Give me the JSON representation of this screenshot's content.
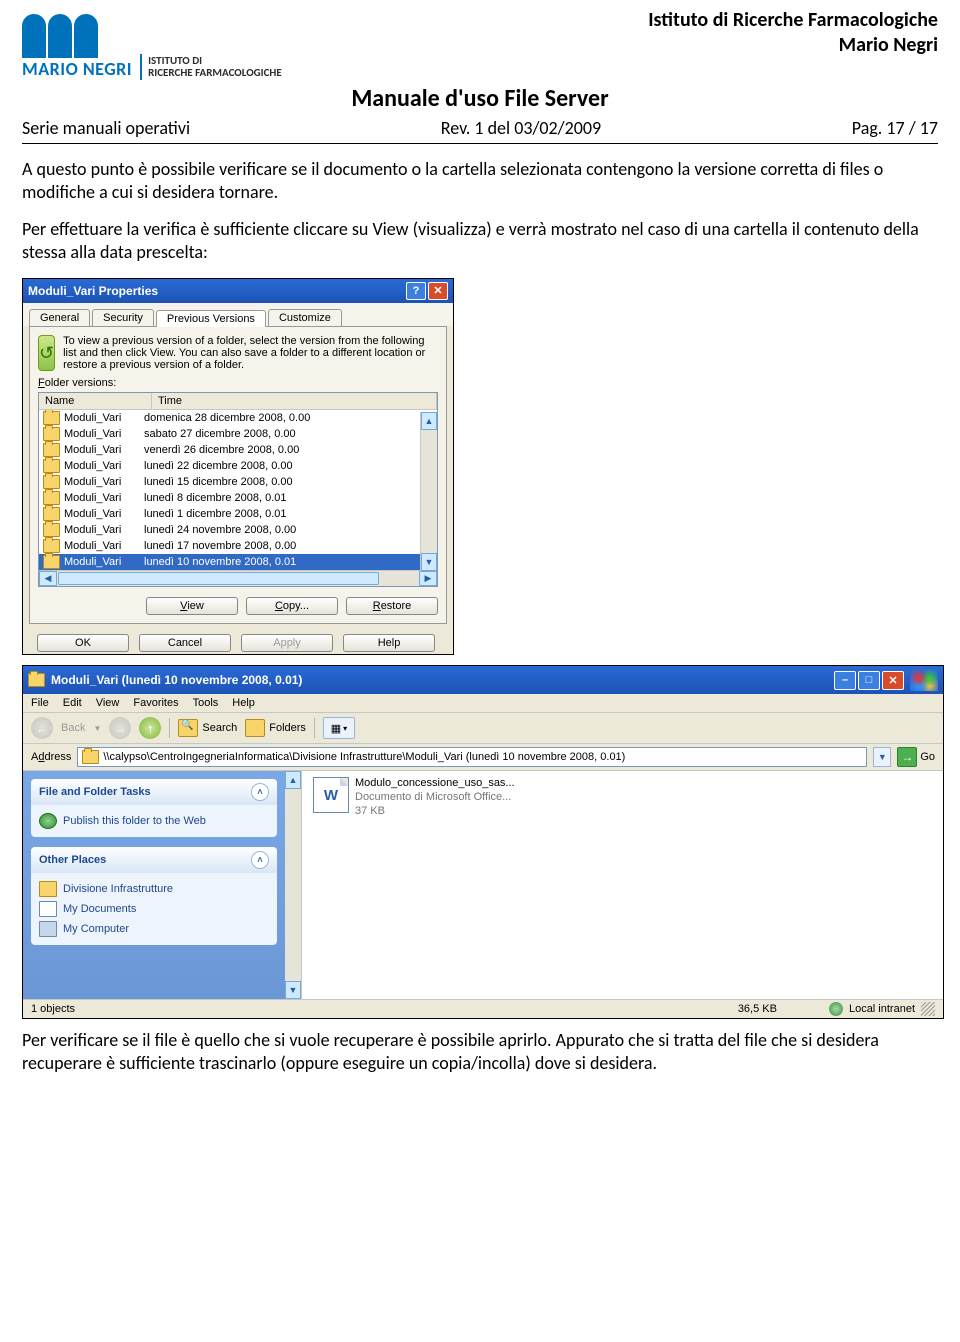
{
  "header": {
    "org_line1": "Istituto di Ricerche Farmacologiche",
    "org_line2": "Mario Negri",
    "logo_main": "MARIO NEGRI",
    "logo_sub": "ISTITUTO DI\nRICERCHE FARMACOLOGICHE",
    "title": "Manuale d'uso File Server",
    "series": "Serie manuali operativi",
    "rev": "Rev. 1 del 03/02/2009",
    "page": "Pag. 17 / 17"
  },
  "body": {
    "p1": "A questo punto è possibile verificare se il documento o la cartella selezionata contengono la versione corretta di files o modifiche a cui si desidera tornare.",
    "p2": "Per effettuare la verifica è sufficiente cliccare su View (visualizza) e verrà mostrato nel caso di una cartella il contenuto della stessa alla data prescelta:",
    "p3": "Per verificare se il file è quello che si vuole recuperare è possibile aprirlo. Appurato che si tratta del file che si desidera recuperare è sufficiente trascinarlo (oppure eseguire un copia/incolla) dove si desidera."
  },
  "dialog": {
    "title": "Moduli_Vari Properties",
    "tabs": [
      "General",
      "Security",
      "Previous Versions",
      "Customize"
    ],
    "intro": "To view a previous version of a folder, select the version from the following list and then click View. You can also save a folder to a different location or restore a previous version of a folder.",
    "versions_label": "Folder versions:",
    "cols": {
      "name": "Name",
      "time": "Time"
    },
    "rows": [
      {
        "name": "Moduli_Vari",
        "time": "domenica 28 dicembre 2008, 0.00"
      },
      {
        "name": "Moduli_Vari",
        "time": "sabato 27 dicembre 2008, 0.00"
      },
      {
        "name": "Moduli_Vari",
        "time": "venerdì 26 dicembre 2008, 0.00"
      },
      {
        "name": "Moduli_Vari",
        "time": "lunedì 22 dicembre 2008, 0.00"
      },
      {
        "name": "Moduli_Vari",
        "time": "lunedì 15 dicembre 2008, 0.00"
      },
      {
        "name": "Moduli_Vari",
        "time": "lunedì 8 dicembre 2008, 0.01"
      },
      {
        "name": "Moduli_Vari",
        "time": "lunedì 1 dicembre 2008, 0.01"
      },
      {
        "name": "Moduli_Vari",
        "time": "lunedì 24 novembre 2008, 0.00"
      },
      {
        "name": "Moduli_Vari",
        "time": "lunedì 17 novembre 2008, 0.00"
      },
      {
        "name": "Moduli_Vari",
        "time": "lunedì 10 novembre 2008, 0.01"
      }
    ],
    "btns": {
      "view": "View",
      "copy": "Copy...",
      "restore": "Restore",
      "ok": "OK",
      "cancel": "Cancel",
      "apply": "Apply",
      "help": "Help"
    }
  },
  "explorer": {
    "title": "Moduli_Vari (lunedì 10 novembre 2008, 0.01)",
    "menu": [
      "File",
      "Edit",
      "View",
      "Favorites",
      "Tools",
      "Help"
    ],
    "toolbar": {
      "back": "Back",
      "search": "Search",
      "folders": "Folders"
    },
    "address_label": "Address",
    "address": "\\\\calypso\\CentroIngegneriaInformatica\\Divisione Infrastrutture\\Moduli_Vari (lunedì 10 novembre 2008, 0.01)",
    "go": "Go",
    "tasks": {
      "title": "File and Folder Tasks",
      "items": [
        "Publish this folder to the Web"
      ]
    },
    "places": {
      "title": "Other Places",
      "items": [
        "Divisione Infrastrutture",
        "My Documents",
        "My Computer"
      ]
    },
    "file": {
      "name": "Modulo_concessione_uso_sas...",
      "type": "Documento di Microsoft Office...",
      "size": "37 KB"
    },
    "status": {
      "objects": "1 objects",
      "size": "36,5 KB",
      "zone": "Local intranet"
    }
  }
}
